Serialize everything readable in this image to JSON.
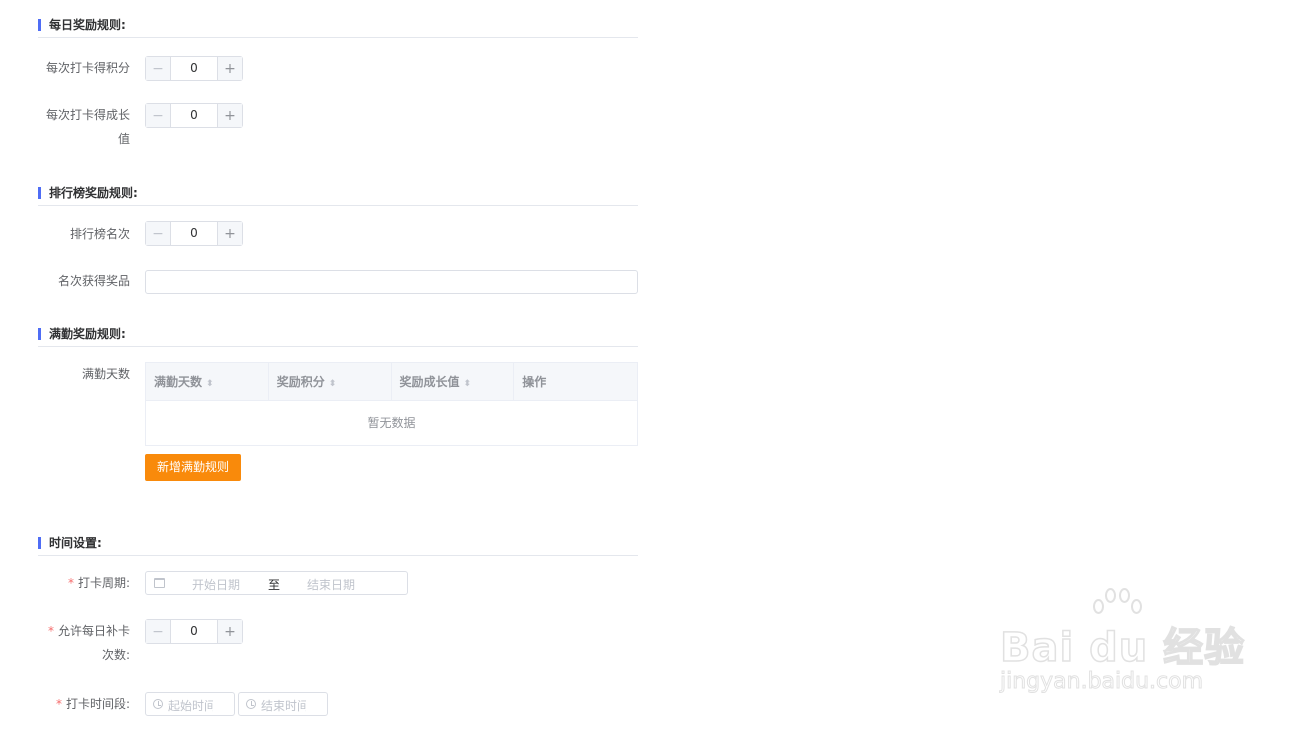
{
  "daily": {
    "title": "每日奖励规则:",
    "points_label": "每次打卡得积分",
    "points_value": "0",
    "growth_label_line1": "每次打卡得成长",
    "growth_label_line2": "值",
    "growth_value": "0"
  },
  "ranking": {
    "title": "排行榜奖励规则:",
    "rank_label": "排行榜名次",
    "rank_value": "0",
    "prize_label": "名次获得奖品",
    "prize_value": ""
  },
  "attendance": {
    "title": "满勤奖励规则:",
    "days_label": "满勤天数",
    "columns": [
      "满勤天数",
      "奖励积分",
      "奖励成长值",
      "操作"
    ],
    "empty_text": "暂无数据",
    "add_button": "新增满勤规则"
  },
  "time": {
    "title": "时间设置:",
    "period_label": "打卡周期:",
    "start_date_placeholder": "开始日期",
    "range_separator": "至",
    "end_date_placeholder": "结束日期",
    "makeup_label_line1": "允许每日补卡",
    "makeup_label_line2": "次数:",
    "makeup_value": "0",
    "time_range_label": "打卡时间段:",
    "start_time_placeholder": "起始时间",
    "end_time_placeholder": "结束时间",
    "required_mark": "*"
  },
  "stepper": {
    "minus": "−",
    "plus": "+"
  },
  "table_sort_icon": "sort-caret-icon",
  "watermark": {
    "brand": "Bai du 经验",
    "url": "jingyan.baidu.com"
  },
  "colors": {
    "accent_bar": "#4f6df5",
    "primary_button": "#f98a0b",
    "required": "#f56c6c"
  }
}
